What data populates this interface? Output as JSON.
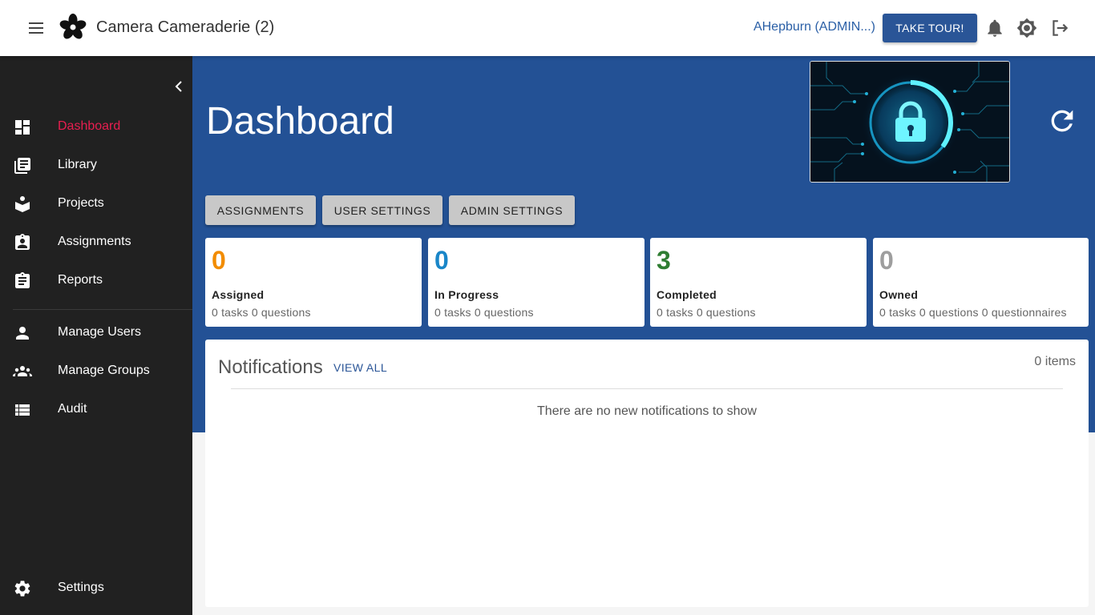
{
  "header": {
    "app_title": "Camera Cameraderie (2)",
    "user_name": "AHepburn (ADMIN...)",
    "tour_button": "TAKE TOUR!"
  },
  "sidebar": {
    "items": [
      {
        "label": "Dashboard",
        "icon": "dashboard-icon",
        "active": true
      },
      {
        "label": "Library",
        "icon": "library-icon"
      },
      {
        "label": "Projects",
        "icon": "projects-icon"
      },
      {
        "label": "Assignments",
        "icon": "assignments-icon"
      },
      {
        "label": "Reports",
        "icon": "reports-icon"
      },
      {
        "label": "Manage Users",
        "icon": "person-icon"
      },
      {
        "label": "Manage Groups",
        "icon": "groups-icon"
      },
      {
        "label": "Audit",
        "icon": "list-icon"
      }
    ],
    "settings_label": "Settings"
  },
  "main": {
    "title": "Dashboard",
    "tabs": [
      "ASSIGNMENTS",
      "USER SETTINGS",
      "ADMIN SETTINGS"
    ],
    "stats": [
      {
        "value": "0",
        "label": "Assigned",
        "sub": "0 tasks 0 questions",
        "color": "#f28c00"
      },
      {
        "value": "0",
        "label": "In Progress",
        "sub": "0 tasks 0 questions",
        "color": "#1a86c8"
      },
      {
        "value": "3",
        "label": "Completed",
        "sub": "0 tasks 0 questions",
        "color": "#2e7d32"
      },
      {
        "value": "0",
        "label": "Owned",
        "sub": "0 tasks 0 questions 0 questionnaires",
        "color": "#9e9e9e"
      }
    ]
  },
  "notifications": {
    "title": "Notifications",
    "view_all": "VIEW ALL",
    "count": "0 items",
    "empty_message": "There are no new notifications to show"
  },
  "colors": {
    "brand": "#235195",
    "active_nav": "#e91e50",
    "sidebar_bg": "#212121"
  }
}
